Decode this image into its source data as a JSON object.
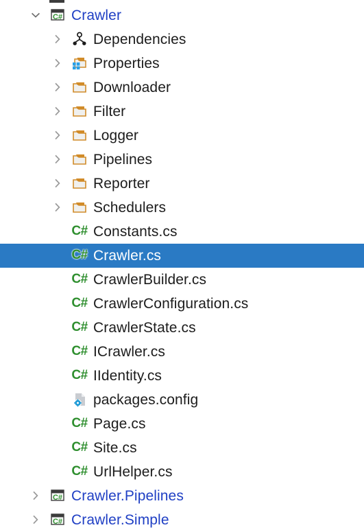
{
  "panel": {
    "name": "solution-explorer-tree",
    "background_color": "#ffffff",
    "selection_color": "#2a7ac4",
    "project_text_color": "#1f3fc4",
    "file_text_color": "#1c1c1c",
    "folder_color": "#d18b28",
    "csharp_green": "#2f8f2f"
  },
  "tree": {
    "items": [
      {
        "label": "Crawler",
        "level": 1,
        "icon": "csharp-project-icon",
        "expander": "chevron-down-icon",
        "selected": false,
        "style": "project"
      },
      {
        "label": "Dependencies",
        "level": 2,
        "icon": "dependencies-icon",
        "expander": "chevron-right-icon",
        "selected": false,
        "style": "normal"
      },
      {
        "label": "Properties",
        "level": 2,
        "icon": "properties-folder-icon",
        "expander": "chevron-right-icon",
        "selected": false,
        "style": "normal"
      },
      {
        "label": "Downloader",
        "level": 2,
        "icon": "folder-icon",
        "expander": "chevron-right-icon",
        "selected": false,
        "style": "normal"
      },
      {
        "label": "Filter",
        "level": 2,
        "icon": "folder-icon",
        "expander": "chevron-right-icon",
        "selected": false,
        "style": "normal"
      },
      {
        "label": "Logger",
        "level": 2,
        "icon": "folder-icon",
        "expander": "chevron-right-icon",
        "selected": false,
        "style": "normal"
      },
      {
        "label": "Pipelines",
        "level": 2,
        "icon": "folder-icon",
        "expander": "chevron-right-icon",
        "selected": false,
        "style": "normal"
      },
      {
        "label": "Reporter",
        "level": 2,
        "icon": "folder-icon",
        "expander": "chevron-right-icon",
        "selected": false,
        "style": "normal"
      },
      {
        "label": "Schedulers",
        "level": 2,
        "icon": "folder-icon",
        "expander": "chevron-right-icon",
        "selected": false,
        "style": "normal"
      },
      {
        "label": "Constants.cs",
        "level": 2,
        "icon": "csharp-file-icon",
        "expander": "none",
        "selected": false,
        "style": "normal"
      },
      {
        "label": "Crawler.cs",
        "level": 2,
        "icon": "csharp-file-icon",
        "expander": "none",
        "selected": true,
        "style": "selected"
      },
      {
        "label": "CrawlerBuilder.cs",
        "level": 2,
        "icon": "csharp-file-icon",
        "expander": "none",
        "selected": false,
        "style": "normal"
      },
      {
        "label": "CrawlerConfiguration.cs",
        "level": 2,
        "icon": "csharp-file-icon",
        "expander": "none",
        "selected": false,
        "style": "normal"
      },
      {
        "label": "CrawlerState.cs",
        "level": 2,
        "icon": "csharp-file-icon",
        "expander": "none",
        "selected": false,
        "style": "normal"
      },
      {
        "label": "ICrawler.cs",
        "level": 2,
        "icon": "csharp-file-icon",
        "expander": "none",
        "selected": false,
        "style": "normal"
      },
      {
        "label": "IIdentity.cs",
        "level": 2,
        "icon": "csharp-file-icon",
        "expander": "none",
        "selected": false,
        "style": "normal"
      },
      {
        "label": "packages.config",
        "level": 2,
        "icon": "config-file-icon",
        "expander": "none",
        "selected": false,
        "style": "normal"
      },
      {
        "label": "Page.cs",
        "level": 2,
        "icon": "csharp-file-icon",
        "expander": "none",
        "selected": false,
        "style": "normal"
      },
      {
        "label": "Site.cs",
        "level": 2,
        "icon": "csharp-file-icon",
        "expander": "none",
        "selected": false,
        "style": "normal"
      },
      {
        "label": "UrlHelper.cs",
        "level": 2,
        "icon": "csharp-file-icon",
        "expander": "none",
        "selected": false,
        "style": "normal"
      },
      {
        "label": "Crawler.Pipelines",
        "level": 1,
        "icon": "csharp-project-icon",
        "expander": "chevron-right-icon",
        "selected": false,
        "style": "project"
      },
      {
        "label": "Crawler.Simple",
        "level": 1,
        "icon": "csharp-project-icon",
        "expander": "chevron-right-icon",
        "selected": false,
        "style": "project"
      }
    ]
  },
  "icon_glyphs": {
    "csharp-file-icon": "C#",
    "csharp-project-icon": "C#"
  }
}
